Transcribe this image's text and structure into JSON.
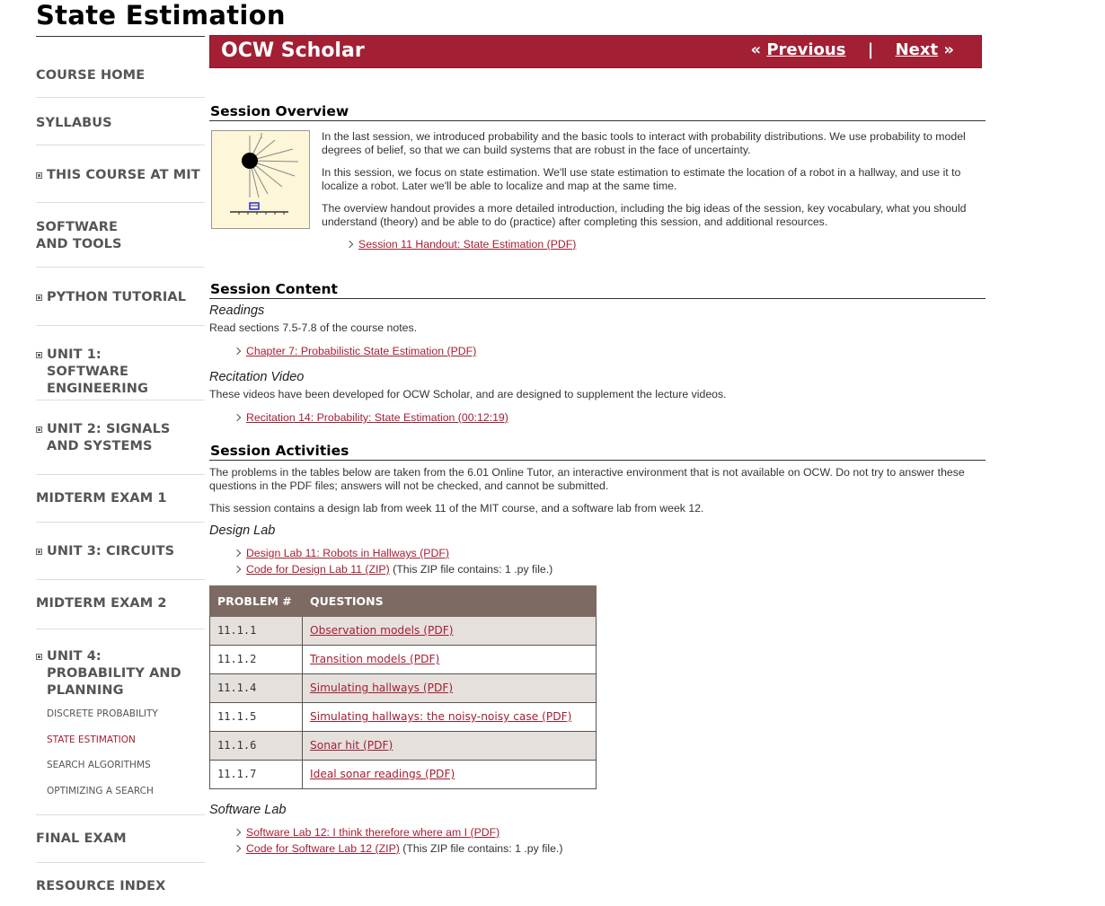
{
  "page_title": "State Estimation",
  "sidebar": {
    "items": [
      {
        "label": "COURSE HOME",
        "expandable": false
      },
      {
        "label": "SYLLABUS",
        "expandable": false
      },
      {
        "label": "THIS COURSE AT MIT",
        "expandable": true
      },
      {
        "label": "SOFTWARE AND TOOLS",
        "expandable": false
      },
      {
        "label": "PYTHON TUTORIAL",
        "expandable": true
      },
      {
        "label": "UNIT 1: SOFTWARE ENGINEERING",
        "expandable": true
      },
      {
        "label": "UNIT 2: SIGNALS AND SYSTEMS",
        "expandable": true
      },
      {
        "label": "MIDTERM EXAM 1",
        "expandable": false
      },
      {
        "label": "UNIT 3: CIRCUITS",
        "expandable": true
      },
      {
        "label": "MIDTERM EXAM 2",
        "expandable": false
      },
      {
        "label": "UNIT 4: PROBABILITY AND PLANNING",
        "expandable": true
      },
      {
        "label": "FINAL EXAM",
        "expandable": false
      },
      {
        "label": "RESOURCE INDEX",
        "expandable": false
      }
    ],
    "unit4_sub": [
      {
        "label": "DISCRETE PROBABILITY",
        "active": false
      },
      {
        "label": "STATE ESTIMATION",
        "active": true
      },
      {
        "label": "SEARCH ALGORITHMS",
        "active": false
      },
      {
        "label": "OPTIMIZING A SEARCH",
        "active": false
      }
    ]
  },
  "banner": {
    "brand": "OCW Scholar",
    "prev_label": "Previous",
    "prev_prefix": "«",
    "separator": "|",
    "next_label": "Next",
    "next_suffix": "»"
  },
  "overview": {
    "title": "Session Overview",
    "paragraphs": [
      "In the last session, we introduced probability and the basic tools to interact with probability distributions. We use probability to model degrees of belief, so that we can build systems that are robust in the face of uncertainty.",
      "In this session, we focus on state estimation. We'll use state estimation to estimate the location of a robot in a hallway, and use it to localize a robot. Later we'll be able to localize and map at the same time.",
      "The overview handout provides a more detailed introduction, including the big ideas of the session, key vocabulary, what you should understand (theory) and be able to do (practice) after completing this session, and additional resources."
    ],
    "handout_link": "Session 11 Handout: State Estimation (PDF)"
  },
  "content": {
    "title": "Session Content",
    "readings_heading": "Readings",
    "readings_text": "Read sections 7.5-7.8 of the course notes.",
    "readings_link": "Chapter 7: Probabilistic State Estimation (PDF)",
    "video_heading": "Recitation Video",
    "video_text": "These videos have been developed for OCW Scholar, and are designed to supplement the lecture videos.",
    "video_link": "Recitation 14: Probability: State Estimation (00:12:19)"
  },
  "activities": {
    "title": "Session Activities",
    "para1": "The problems in the tables below are taken from the 6.01 Online Tutor, an interactive environment that is not available on OCW. Do not try to answer these questions in the PDF files; answers will not be checked, and cannot be submitted.",
    "para2": "This session contains a design lab from week 11 of the MIT course, and a software lab from week 12.",
    "design_heading": "Design Lab",
    "design_link1": "Design Lab 11: Robots in Hallways (PDF)",
    "design_link2": "Code for Design Lab 11 (ZIP)",
    "design_link2_note": " (This ZIP file contains: 1 .py file.)",
    "table_headers": [
      "PROBLEM #",
      "QUESTIONS"
    ],
    "table_rows": [
      {
        "num": "11.1.1",
        "q": "Observation models (PDF)"
      },
      {
        "num": "11.1.2",
        "q": "Transition models (PDF)"
      },
      {
        "num": "11.1.4",
        "q": "Simulating hallways (PDF)"
      },
      {
        "num": "11.1.5",
        "q": "Simulating hallways: the noisy-noisy case (PDF)"
      },
      {
        "num": "11.1.6",
        "q": "Sonar hit (PDF)"
      },
      {
        "num": "11.1.7",
        "q": "Ideal sonar readings (PDF)"
      }
    ],
    "software_heading": "Software Lab",
    "software_link1": "Software Lab 12: I think therefore where am I (PDF)",
    "software_link2": "Code for Software Lab 12 (ZIP)",
    "software_link2_note": " (This ZIP file contains: 1 .py file.)"
  }
}
